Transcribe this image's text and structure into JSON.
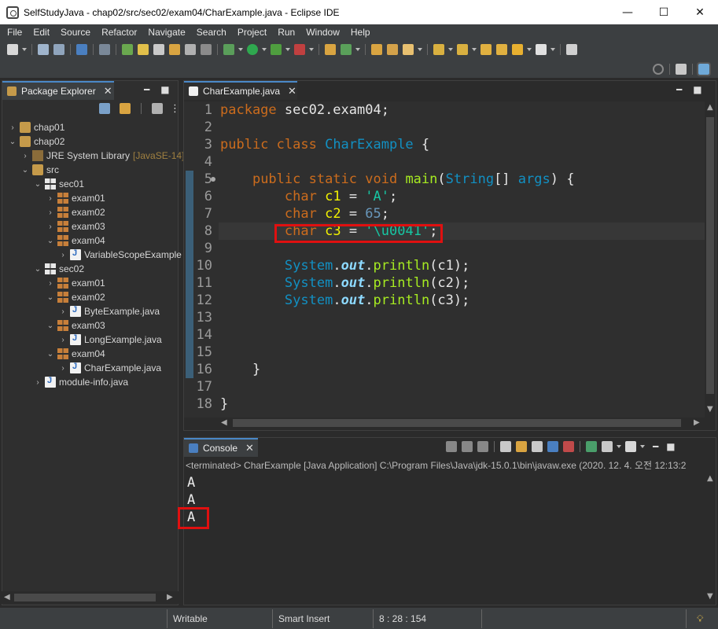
{
  "window": {
    "title": "SelfStudyJava - chap02/src/sec02/exam04/CharExample.java - Eclipse IDE",
    "minimize": "—",
    "maximize": "☐",
    "close": "✕"
  },
  "menu": [
    "File",
    "Edit",
    "Source",
    "Refactor",
    "Navigate",
    "Search",
    "Project",
    "Run",
    "Window",
    "Help"
  ],
  "package_explorer": {
    "title": "Package Explorer",
    "tree": [
      {
        "label": "chap01",
        "suffix": "",
        "arrow": "›",
        "icon": "folder",
        "indent": 0
      },
      {
        "label": "chap02",
        "suffix": "",
        "arrow": "⌄",
        "icon": "folder",
        "indent": 0
      },
      {
        "label": "JRE System Library",
        "suffix": "[JavaSE-14]",
        "arrow": "›",
        "icon": "lib",
        "indent": 1
      },
      {
        "label": "src",
        "suffix": "",
        "arrow": "⌄",
        "icon": "folder",
        "indent": 1
      },
      {
        "label": "sec01",
        "suffix": "",
        "arrow": "⌄",
        "icon": "pkg-white",
        "indent": 2
      },
      {
        "label": "exam01",
        "suffix": "",
        "arrow": "›",
        "icon": "pkg",
        "indent": 3
      },
      {
        "label": "exam02",
        "suffix": "",
        "arrow": "›",
        "icon": "pkg",
        "indent": 3
      },
      {
        "label": "exam03",
        "suffix": "",
        "arrow": "›",
        "icon": "pkg",
        "indent": 3
      },
      {
        "label": "exam04",
        "suffix": "",
        "arrow": "⌄",
        "icon": "pkg",
        "indent": 3
      },
      {
        "label": "VariableScopeExample",
        "suffix": "",
        "arrow": "›",
        "icon": "java",
        "indent": 4
      },
      {
        "label": "sec02",
        "suffix": "",
        "arrow": "⌄",
        "icon": "pkg-white",
        "indent": 2
      },
      {
        "label": "exam01",
        "suffix": "",
        "arrow": "›",
        "icon": "pkg",
        "indent": 3
      },
      {
        "label": "exam02",
        "suffix": "",
        "arrow": "⌄",
        "icon": "pkg",
        "indent": 3
      },
      {
        "label": "ByteExample.java",
        "suffix": "",
        "arrow": "›",
        "icon": "java",
        "indent": 4
      },
      {
        "label": "exam03",
        "suffix": "",
        "arrow": "⌄",
        "icon": "pkg",
        "indent": 3
      },
      {
        "label": "LongExample.java",
        "suffix": "",
        "arrow": "›",
        "icon": "java",
        "indent": 4
      },
      {
        "label": "exam04",
        "suffix": "",
        "arrow": "⌄",
        "icon": "pkg",
        "indent": 3
      },
      {
        "label": "CharExample.java",
        "suffix": "",
        "arrow": "›",
        "icon": "java",
        "indent": 4
      },
      {
        "label": "module-info.java",
        "suffix": "",
        "arrow": "›",
        "icon": "java",
        "indent": 2
      }
    ]
  },
  "editor": {
    "tab_title": "CharExample.java",
    "line_numbers": [
      "1",
      "2",
      "3",
      "4",
      "5",
      "6",
      "7",
      "8",
      "9",
      "10",
      "11",
      "12",
      "13",
      "14",
      "15",
      "16",
      "17",
      "18"
    ],
    "code": {
      "l1_kw": "package",
      "l1_rest": " sec02.exam04;",
      "l3_kw": "public class",
      "l3_cls": "CharExample",
      "l3_rest": " {",
      "l5_kw": "public static void",
      "l5_mth": "main",
      "l5_p1": "(",
      "l5_typ": "String",
      "l5_p2": "[] ",
      "l5_arg": "args",
      "l5_p3": ") {",
      "l6_kw": "char",
      "l6_var": "c1",
      "l6_eq": " = ",
      "l6_str": "'A'",
      "l6_end": ";",
      "l7_kw": "char",
      "l7_var": "c2",
      "l7_eq": " = ",
      "l7_num": "65",
      "l7_end": ";",
      "l8_kw": "char",
      "l8_var": "c3",
      "l8_eq": " = ",
      "l8_str": "'\\u0041'",
      "l8_end": ";",
      "l10_cls": "System",
      "l10_dot1": ".",
      "l10_fld": "out",
      "l10_dot2": ".",
      "l10_mth": "println",
      "l10_args": "(c1);",
      "l11_cls": "System",
      "l11_dot1": ".",
      "l11_fld": "out",
      "l11_dot2": ".",
      "l11_mth": "println",
      "l11_args": "(c2);",
      "l12_cls": "System",
      "l12_dot1": ".",
      "l12_fld": "out",
      "l12_dot2": ".",
      "l12_mth": "println",
      "l12_args": "(c3);",
      "l16_brace": "}",
      "l18_brace": "}"
    }
  },
  "console": {
    "tab_title": "Console",
    "status": "<terminated> CharExample [Java Application] C:\\Program Files\\Java\\jdk-15.0.1\\bin\\javaw.exe  (2020. 12. 4. 오전 12:13:2",
    "output": [
      "A",
      "A",
      "A"
    ]
  },
  "statusbar": {
    "writable": "Writable",
    "insert_mode": "Smart Insert",
    "position": "8 : 28 : 154"
  },
  "colors": {
    "highlight_box": "#e01010",
    "accent": "#4a88c7"
  }
}
